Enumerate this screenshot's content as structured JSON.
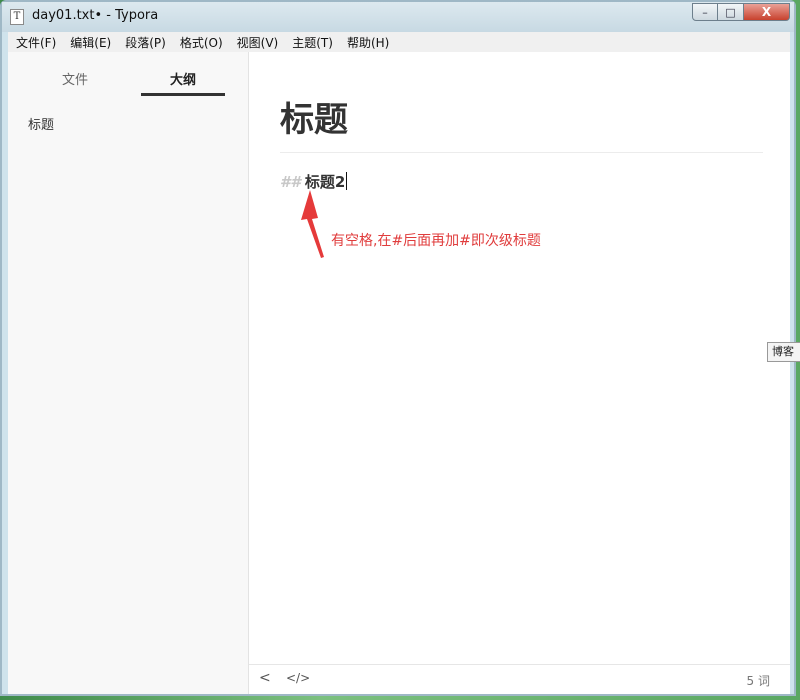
{
  "window": {
    "title": "day01.txt• - Typora",
    "app_icon_glyph": "T",
    "controls": {
      "minimize": "–",
      "maximize": "□",
      "close": "X"
    }
  },
  "menubar": {
    "items": [
      "文件(F)",
      "编辑(E)",
      "段落(P)",
      "格式(O)",
      "视图(V)",
      "主题(T)",
      "帮助(H)"
    ]
  },
  "sidebar": {
    "tabs": {
      "files": "文件",
      "outline": "大纲"
    },
    "active_tab": "outline",
    "outline_items": [
      "标题"
    ]
  },
  "editor": {
    "h1": "标题",
    "h2_marker": "##",
    "h2_text": "标题2",
    "annotation": "有空格,在#后面再加#即次级标题"
  },
  "statusbar": {
    "back_icon": "<",
    "code_icon": "</>",
    "word_count": "5 词"
  },
  "tooltip": {
    "text": "博客"
  },
  "colors": {
    "annotation": "#e03c3c",
    "accent": "#333333"
  }
}
